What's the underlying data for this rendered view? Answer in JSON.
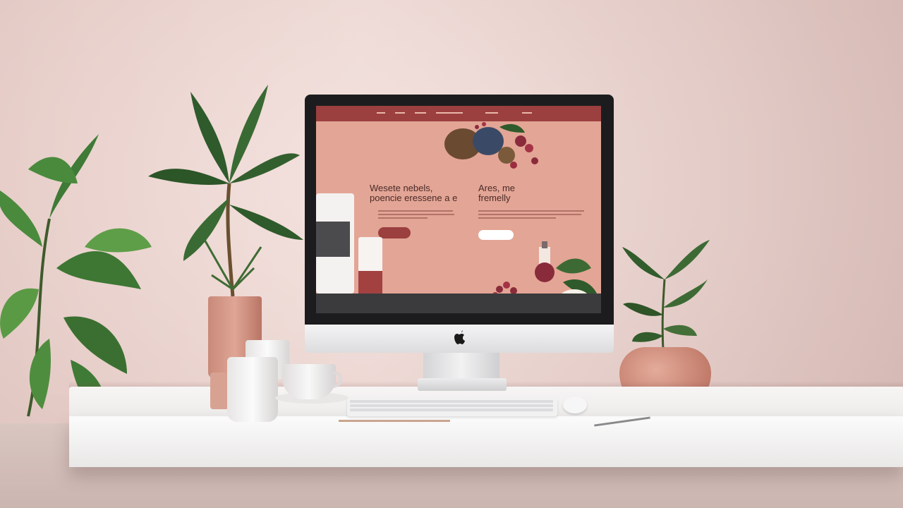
{
  "scene": {
    "description_free": true
  },
  "screen_site": {
    "nav_items": [
      "",
      "",
      "",
      "",
      "",
      ""
    ],
    "headline_left": "Wesete nebels,\npoencie eressene a e",
    "headline_right": "Ares, me\nfremelly",
    "left_button": "",
    "right_button": ""
  },
  "colors": {
    "wall": "#ead2cd",
    "site_bg": "#e3a595",
    "nav_bar": "#9c3f3f",
    "pot": "#d4917f"
  },
  "icons": {
    "monitor_logo": "apple-icon"
  }
}
